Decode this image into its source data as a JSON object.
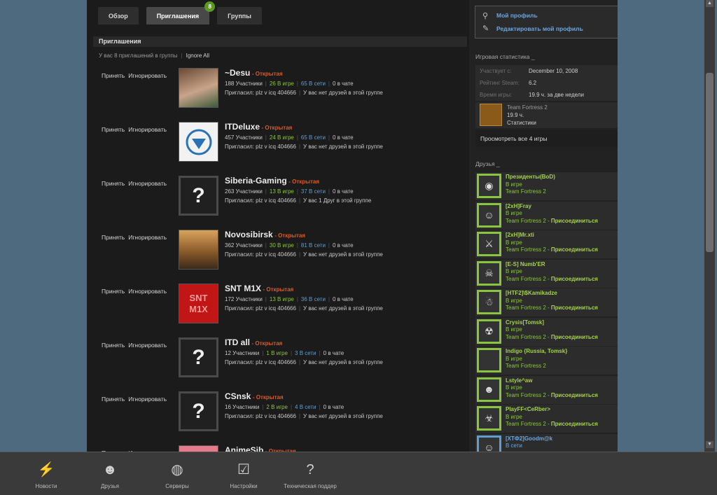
{
  "tabs": [
    {
      "label": "Обзор"
    },
    {
      "label": "Приглашения",
      "badge": "8"
    },
    {
      "label": "Группы"
    }
  ],
  "section_title": "Приглашения",
  "summary": {
    "text": "У вас 8 приглашений в группы",
    "ignore_all": "Ignore All"
  },
  "invite_actions": {
    "accept": "Принять",
    "ignore": "Игнорировать"
  },
  "invites": [
    {
      "name": "~Desu",
      "type": "- Открытая",
      "members": "188 Участники",
      "ingame": "26 В игре",
      "online": "65 В сети",
      "chat": "0 в чате",
      "inviter": "Пригласил: plz v icq 404666",
      "friends": "У вас нет друзей в этой группе",
      "avatar": "anime"
    },
    {
      "name": "ITDeluxe",
      "type": "- Открытая",
      "members": "457 Участники",
      "ingame": "24 В игре",
      "online": "65 В сети",
      "chat": "0 в чате",
      "inviter": "Пригласил: plz v icq 404666",
      "friends": "У вас нет друзей в этой группе",
      "avatar": "diamond"
    },
    {
      "name": "Siberia-Gaming",
      "type": "- Открытая",
      "members": "263 Участники",
      "ingame": "13 В игре",
      "online": "37 В сети",
      "chat": "0 в чате",
      "inviter": "Пригласил: plz v icq 404666",
      "friends_pre": "У вас",
      "friends_strong": "1 Друг",
      "friends_post": "в этой группе",
      "avatar": "q"
    },
    {
      "name": "Novosibirsk",
      "type": "- Открытая",
      "members": "362 Участники",
      "ingame": "30 В игре",
      "online": "81 В сети",
      "chat": "0 в чате",
      "inviter": "Пригласил: plz v icq 404666",
      "friends": "У вас нет друзей в этой группе",
      "avatar": "sunset"
    },
    {
      "name": "SNT M1X",
      "type": "- Открытая",
      "members": "172 Участники",
      "ingame": "13 В игре",
      "online": "36 В сети",
      "chat": "0 в чате",
      "inviter": "Пригласил: plz v icq 404666",
      "friends": "У вас нет друзей в этой группе",
      "avatar": "snt",
      "avatar_text": "SNT M1X"
    },
    {
      "name": "ITD all",
      "type": "- Открытая",
      "members": "12 Участники",
      "ingame": "1 В игре",
      "online": "3 В сети",
      "chat": "0 в чате",
      "inviter": "Пригласил: plz v icq 404666",
      "friends": "У вас нет друзей в этой группе",
      "avatar": "q"
    },
    {
      "name": "CSnsk",
      "type": "- Открытая",
      "members": "16 Участники",
      "ingame": "2 В игре",
      "online": "4 В сети",
      "chat": "0 в чате",
      "inviter": "Пригласил: plz v icq 404666",
      "friends": "У вас нет друзей в этой группе",
      "avatar": "q"
    },
    {
      "name": "AnimeSib",
      "type": "- Открытая",
      "avatar": "pink"
    }
  ],
  "profile": {
    "my_profile": "Мой профиль",
    "edit_profile": "Редактировать мой профиль"
  },
  "stats": {
    "heading": "Игровая статистика _",
    "member_since_label": "Участвует с:",
    "member_since": "December 10, 2008",
    "rating_label": "Рейтинг Steam:",
    "rating": "6.2",
    "playtime_label": "Время игры:",
    "playtime": "19.9 ч. за две недели",
    "game_name": "Team Fortress 2",
    "game_hours": "19.9 ч.",
    "game_stats": "Статистики",
    "view_all": "Просмотреть все 4 игры"
  },
  "friends_heading": "Друзья _",
  "join_label": "Присоединиться",
  "friends": [
    {
      "name": "Президенты(BoD)",
      "status": "В игре",
      "game": "Team Fortress 2",
      "join": false
    },
    {
      "name": "[2xH]Fray",
      "status": "В игре",
      "game": "Team Fortress 2 -",
      "join": true
    },
    {
      "name": "[2xH]Mr.xti",
      "status": "В игре",
      "game": "Team Fortress 2 -",
      "join": true
    },
    {
      "name": "[E-S] Numb'ER",
      "status": "В игре",
      "game": "Team Fortress 2 -",
      "join": true
    },
    {
      "name": "[HTF2]\\$Kamikadze",
      "status": "В игре",
      "game": "Team Fortress 2 -",
      "join": true
    },
    {
      "name": "Crysis[Tomsk]",
      "status": "В игре",
      "game": "Team Fortress 2 -",
      "join": true
    },
    {
      "name": "Indigo {Russia, Tomsk}",
      "status": "В игре",
      "game": "Team Fortress 2",
      "join": false
    },
    {
      "name": "Lstyle^aw",
      "status": "В игре",
      "game": "Team Fortress 2 -",
      "join": true
    },
    {
      "name": "PlayFF<CeRber>",
      "status": "В игре",
      "game": "Team Fortress 2 -",
      "join": true
    },
    {
      "name": "[XTФ2]Goodm@k",
      "status": "В сети",
      "game": "",
      "join": false,
      "online": true
    }
  ],
  "bottom_nav": [
    {
      "label": "Новости",
      "icon": "news-icon"
    },
    {
      "label": "Друзья",
      "icon": "friends-icon"
    },
    {
      "label": "Серверы",
      "icon": "servers-icon"
    },
    {
      "label": "Настройки",
      "icon": "settings-icon"
    },
    {
      "label": "Техническая поддер",
      "icon": "help-icon"
    }
  ]
}
